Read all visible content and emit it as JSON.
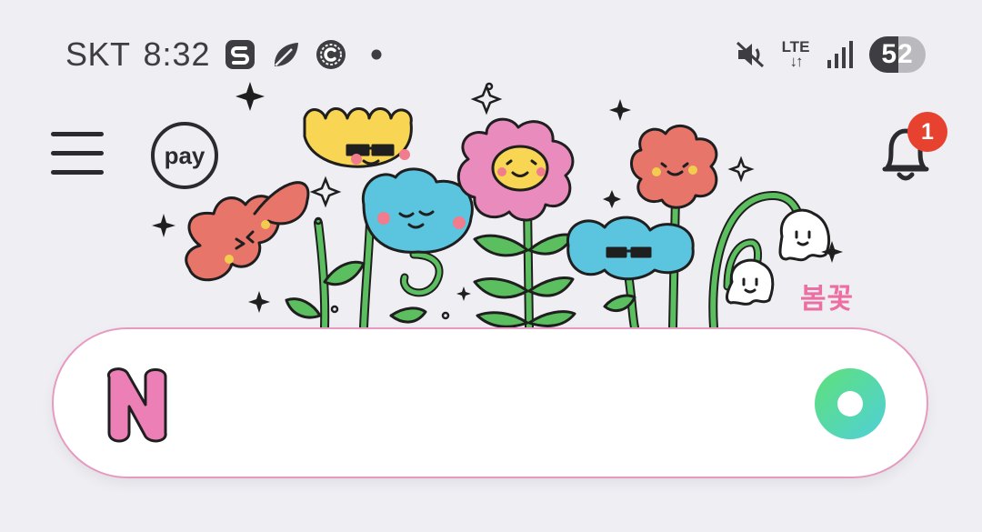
{
  "status_bar": {
    "carrier": "SKT",
    "time": "8:32",
    "left_icons": [
      "s-app-icon",
      "leaf-app-icon",
      "c-app-icon",
      "notification-dot-icon"
    ],
    "network": {
      "type": "LTE",
      "arrows": "↓↑"
    },
    "battery_level": "52",
    "battery_fraction": 0.52,
    "right_icons": [
      "mute-icon",
      "lte-icon",
      "signal-icon",
      "battery-icon"
    ]
  },
  "header": {
    "pay_label": "pay",
    "notification_count": "1",
    "icons": [
      "menu-icon",
      "pay-icon",
      "bell-icon"
    ]
  },
  "doodle": {
    "caption": "봄꽃"
  },
  "search": {
    "placeholder": "",
    "value": "",
    "logo_letter": "N",
    "colors": {
      "border": "#e79ac1",
      "logo": "#ec7fb5",
      "lens_start": "#5fe07a",
      "lens_end": "#4fd0d8"
    }
  }
}
